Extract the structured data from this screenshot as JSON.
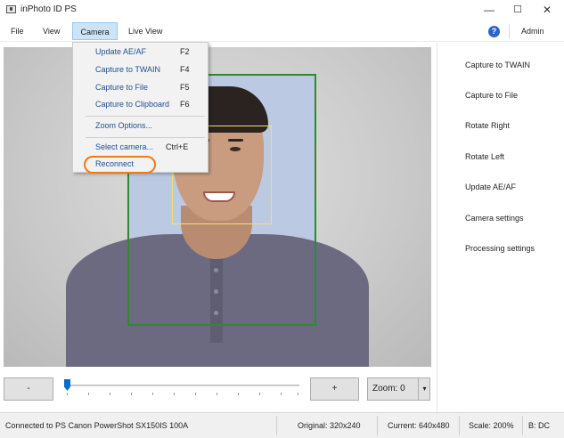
{
  "window": {
    "title": "inPhoto ID PS",
    "minimize_glyph": "—",
    "maximize_glyph": "☐",
    "close_glyph": "✕"
  },
  "menu": {
    "items": [
      "File",
      "View",
      "Camera",
      "Live View"
    ],
    "admin_label": "Admin",
    "help_icon": "?"
  },
  "camera_menu": {
    "items": [
      {
        "label": "Update AE/AF",
        "shortcut": "F2"
      },
      {
        "label": "Capture to TWAIN",
        "shortcut": "F4"
      },
      {
        "label": "Capture to File",
        "shortcut": "F5"
      },
      {
        "label": "Capture to Clipboard",
        "shortcut": "F6"
      },
      {
        "label": "Zoom Options...",
        "shortcut": ""
      },
      {
        "label": "Select camera...",
        "shortcut": "Ctrl+E"
      },
      {
        "label": "Reconnect",
        "shortcut": ""
      }
    ],
    "highlight_color": "#ef7a1a"
  },
  "right_panel": {
    "items": [
      "Capture to TWAIN",
      "Capture to File",
      "Rotate Right",
      "Rotate Left",
      "Update AE/AF",
      "Camera settings",
      "Processing settings"
    ]
  },
  "controls": {
    "minus_label": "-",
    "plus_label": "+",
    "zoom_label": "Zoom: 0",
    "zoom_arrow": "▾",
    "zoom_slider_value": 0
  },
  "status": {
    "connection": "Connected to PS Canon PowerShot SX150IS 100A",
    "original": "Original: 320x240",
    "current": "Current: 640x480",
    "scale": "Scale: 200%",
    "b": "B: DC"
  },
  "colors": {
    "frame_green": "#2f8a2f",
    "face_yellow": "#f0e460",
    "menu_text_blue": "#1d4f91",
    "accent_blue": "#0a6ad0"
  }
}
